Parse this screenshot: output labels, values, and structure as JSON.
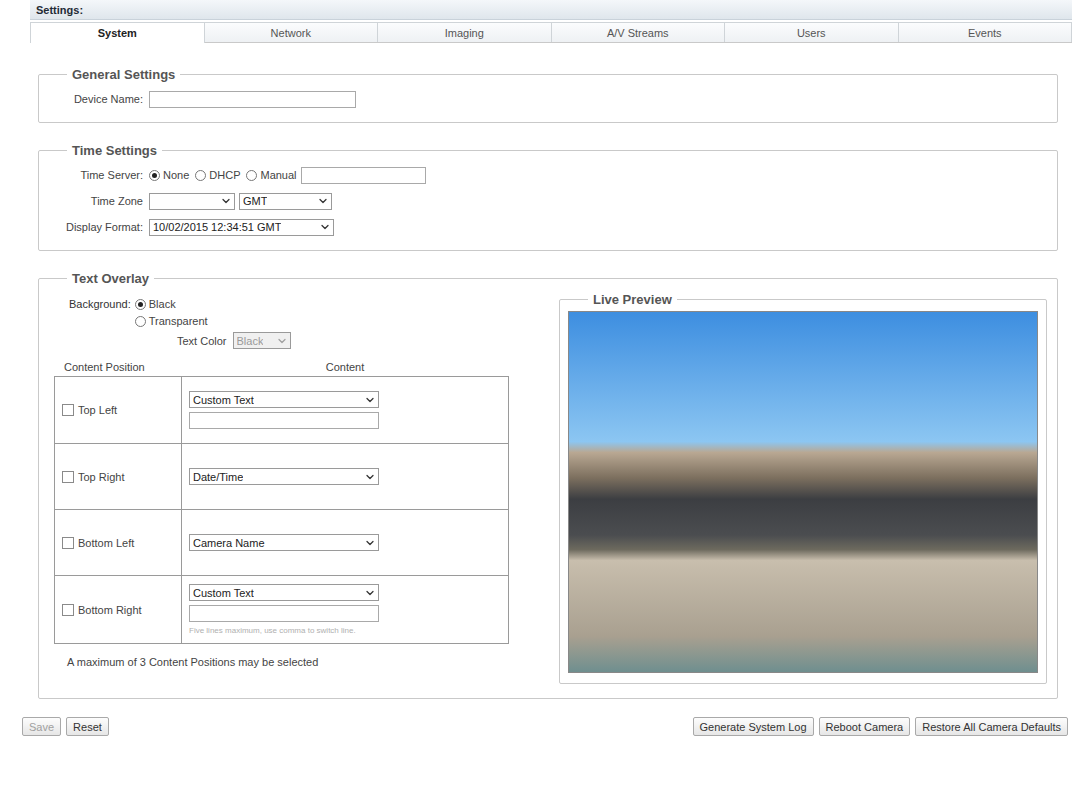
{
  "header": {
    "title": "Settings:"
  },
  "tabs": [
    {
      "label": "System",
      "selected": true
    },
    {
      "label": "Network",
      "selected": false
    },
    {
      "label": "Imaging",
      "selected": false
    },
    {
      "label": "A/V Streams",
      "selected": false
    },
    {
      "label": "Users",
      "selected": false
    },
    {
      "label": "Events",
      "selected": false
    }
  ],
  "general": {
    "legend": "General Settings",
    "device_name": {
      "label": "Device Name:",
      "value": ""
    }
  },
  "time": {
    "legend": "Time Settings",
    "time_server": {
      "label": "Time Server:",
      "options": [
        {
          "label": "None",
          "selected": true
        },
        {
          "label": "DHCP",
          "selected": false
        },
        {
          "label": "Manual",
          "selected": false
        }
      ],
      "manual_value": ""
    },
    "time_zone": {
      "label": "Time Zone",
      "zone": "",
      "offset": "GMT"
    },
    "display_format": {
      "label": "Display Format:",
      "value": "10/02/2015 12:34:51 GMT"
    }
  },
  "overlay": {
    "legend": "Text Overlay",
    "background": {
      "label": "Background:",
      "options": [
        {
          "label": "Black",
          "selected": true
        },
        {
          "label": "Transparent",
          "selected": false
        }
      ]
    },
    "text_color": {
      "label": "Text Color",
      "value": "Black",
      "disabled": true
    },
    "columns": [
      "Content Position",
      "Content"
    ],
    "rows": [
      {
        "position": "Top Left",
        "checked": false,
        "content": "Custom Text",
        "kind": "custom",
        "value": ""
      },
      {
        "position": "Top Right",
        "checked": false,
        "content": "Date/Time",
        "kind": "select"
      },
      {
        "position": "Bottom Left",
        "checked": false,
        "content": "Camera Name",
        "kind": "select"
      },
      {
        "position": "Bottom Right",
        "checked": false,
        "content": "Custom Text",
        "kind": "custom",
        "value": "",
        "hint": "Five lines maximum, use comma to switch line."
      }
    ],
    "note": "A maximum of 3 Content Positions may be selected"
  },
  "preview": {
    "legend": "Live Preview"
  },
  "buttons_left": [
    {
      "label": "Save",
      "disabled": true
    },
    {
      "label": "Reset",
      "disabled": false
    }
  ],
  "buttons_right": [
    {
      "label": "Generate System Log",
      "disabled": false
    },
    {
      "label": "Reboot Camera",
      "disabled": false
    },
    {
      "label": "Restore All Camera Defaults",
      "disabled": false
    }
  ]
}
